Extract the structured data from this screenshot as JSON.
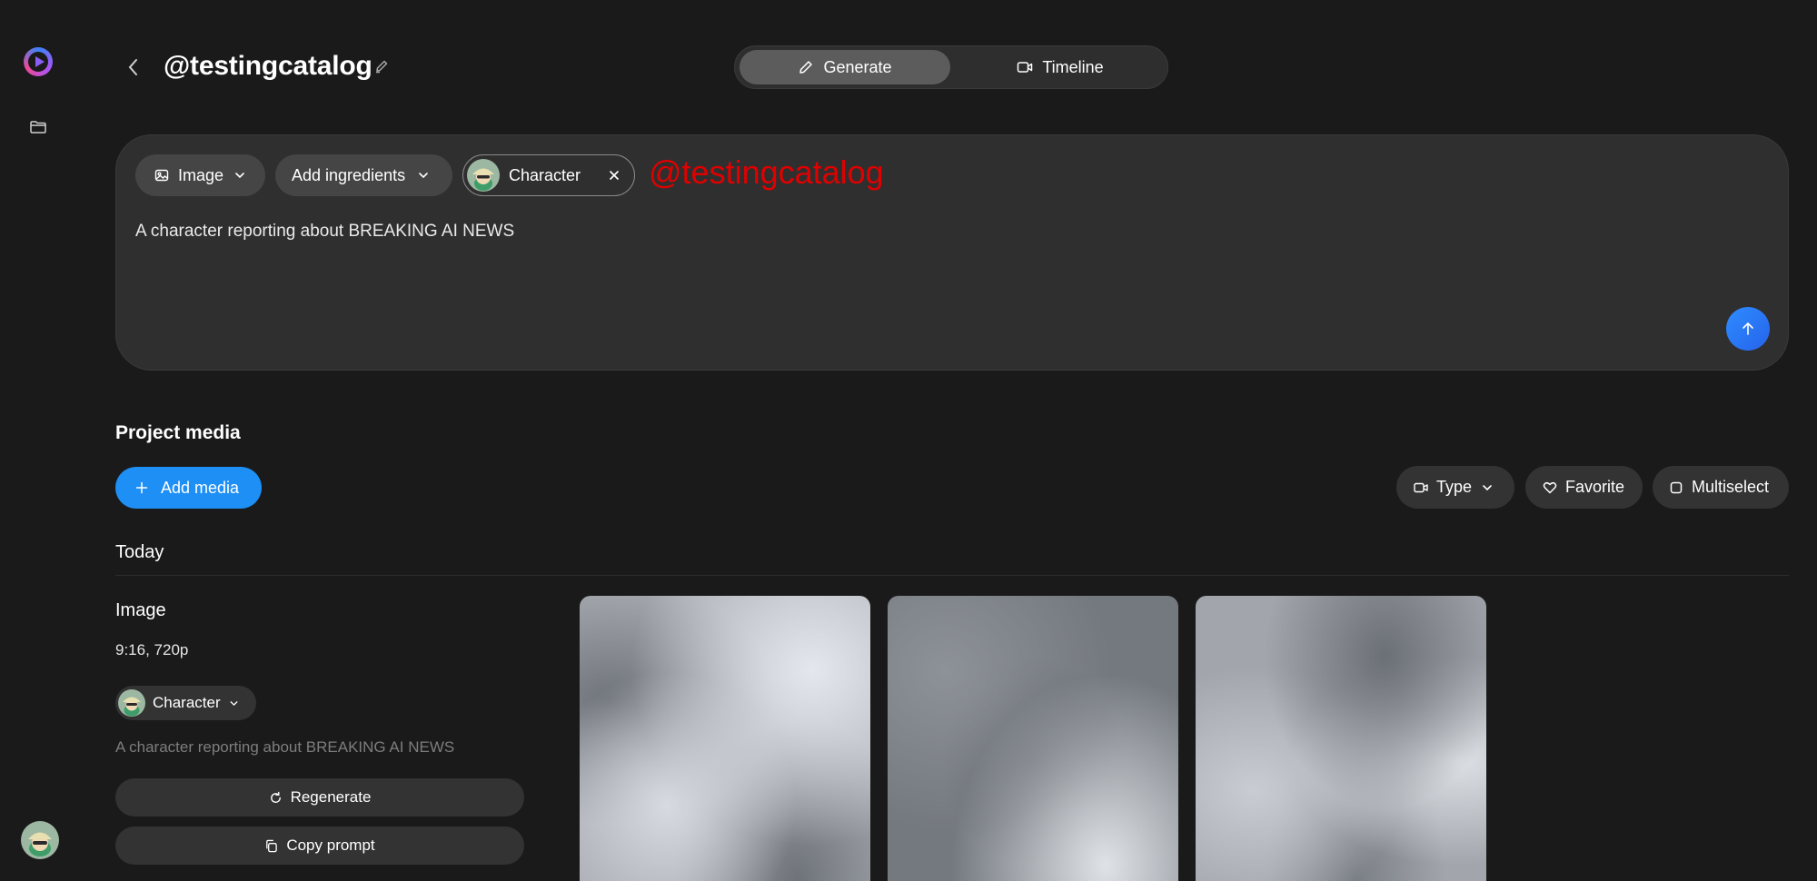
{
  "project": {
    "title": "@testingcatalog"
  },
  "modes": {
    "generate": "Generate",
    "timeline": "Timeline"
  },
  "prompt": {
    "media_type": "Image",
    "ingredients": "Add ingredients",
    "character": "Character",
    "watermark": "@testingcatalog",
    "text": "A character reporting about BREAKING AI NEWS"
  },
  "media": {
    "section_title": "Project media",
    "add_label": "Add media",
    "filters": {
      "type": "Type",
      "favorite": "Favorite",
      "multiselect": "Multiselect"
    },
    "group_label": "Today",
    "item": {
      "type": "Image",
      "spec": "9:16, 720p",
      "character": "Character",
      "prompt": "A character reporting about BREAKING AI NEWS",
      "regenerate": "Regenerate",
      "copy_prompt": "Copy prompt"
    }
  },
  "colors": {
    "accent": "#1e8ff5",
    "watermark": "#e00000",
    "background": "#1a1a1a"
  }
}
